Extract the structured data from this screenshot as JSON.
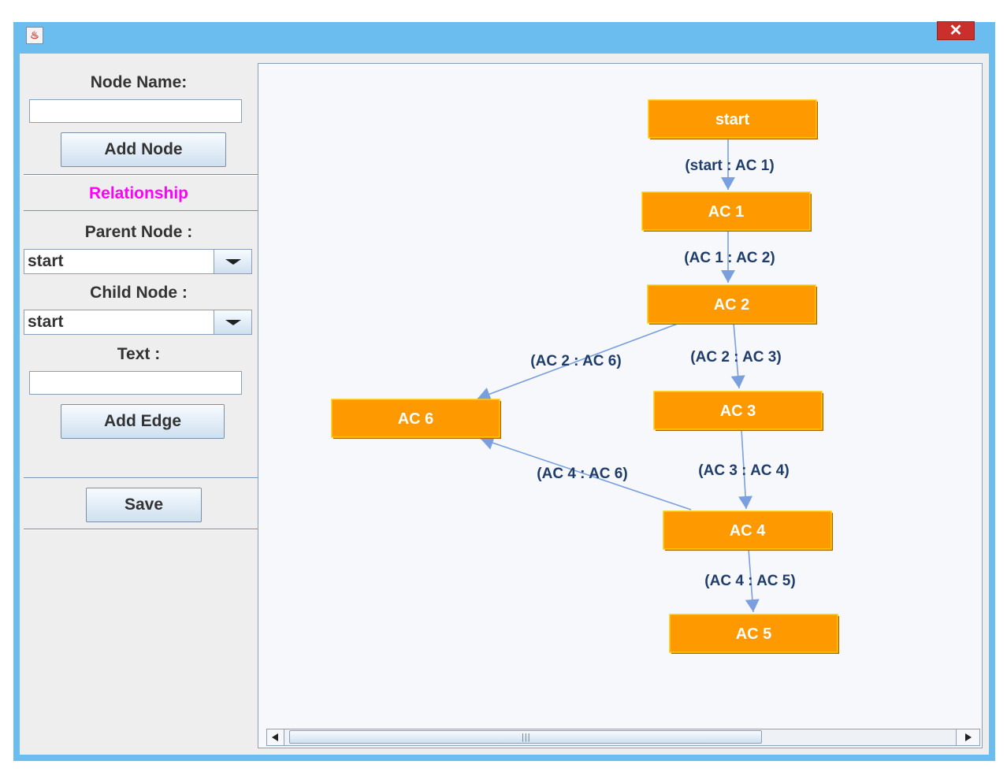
{
  "window": {
    "close_label": "✕",
    "app_icon": "java-cup-icon"
  },
  "sidebar": {
    "node_name_label": "Node Name:",
    "node_name_value": "",
    "add_node_label": "Add Node",
    "relationship_label": "Relationship",
    "relationship_color": "#ff00ff",
    "parent_label": "Parent Node :",
    "parent_value": "start",
    "child_label": "Child Node :",
    "child_value": "start",
    "text_label": "Text :",
    "text_value": "",
    "add_edge_label": "Add Edge",
    "save_label": "Save"
  },
  "graph": {
    "node_color": "#ff9900",
    "edge_color": "#7a9fde",
    "label_color": "#1f3d6b",
    "nodes": [
      {
        "id": "start",
        "label": "start"
      },
      {
        "id": "ac1",
        "label": "AC 1"
      },
      {
        "id": "ac2",
        "label": "AC 2"
      },
      {
        "id": "ac3",
        "label": "AC 3"
      },
      {
        "id": "ac4",
        "label": "AC 4"
      },
      {
        "id": "ac5",
        "label": "AC 5"
      },
      {
        "id": "ac6",
        "label": "AC 6"
      }
    ],
    "edges": [
      {
        "from": "start",
        "to": "ac1",
        "label": "(start : AC 1)"
      },
      {
        "from": "ac1",
        "to": "ac2",
        "label": "(AC 1 : AC 2)"
      },
      {
        "from": "ac2",
        "to": "ac3",
        "label": "(AC 2 : AC 3)"
      },
      {
        "from": "ac2",
        "to": "ac6",
        "label": "(AC 2 : AC 6)"
      },
      {
        "from": "ac3",
        "to": "ac4",
        "label": "(AC 3 : AC 4)"
      },
      {
        "from": "ac4",
        "to": "ac6",
        "label": "(AC 4 : AC 6)"
      },
      {
        "from": "ac4",
        "to": "ac5",
        "label": "(AC 4 : AC 5)"
      }
    ]
  }
}
